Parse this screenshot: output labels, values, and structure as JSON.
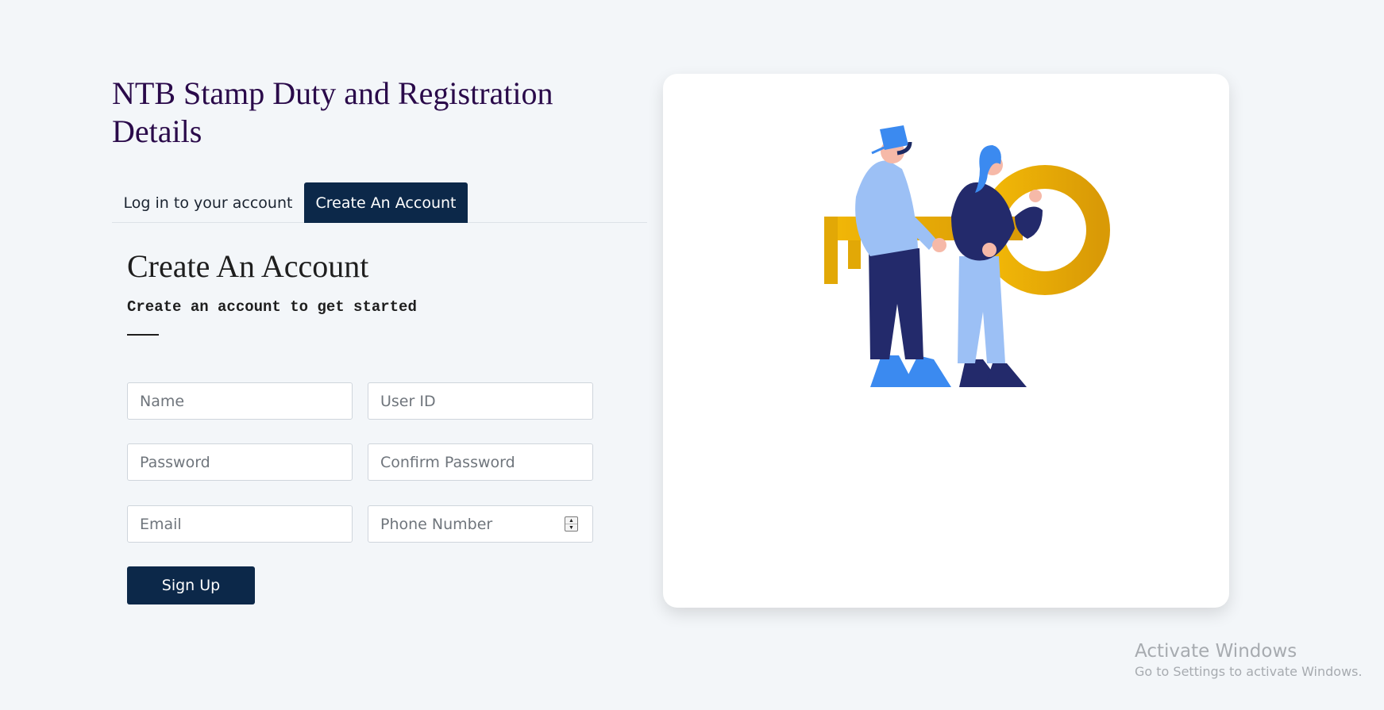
{
  "app": {
    "title": "NTB Stamp Duty and Registration Details"
  },
  "tabs": [
    {
      "label": "Log in to your account",
      "active": false
    },
    {
      "label": "Create An Account",
      "active": true
    }
  ],
  "form": {
    "heading": "Create An Account",
    "subheading": "Create an account to get started",
    "fields": {
      "name": {
        "placeholder": "Name",
        "value": ""
      },
      "user_id": {
        "placeholder": "User ID",
        "value": ""
      },
      "password": {
        "placeholder": "Password",
        "value": ""
      },
      "confirm_password": {
        "placeholder": "Confirm Password",
        "value": ""
      },
      "email": {
        "placeholder": "Email",
        "value": ""
      },
      "phone": {
        "placeholder": "Phone Number",
        "value": ""
      }
    },
    "submit_label": "Sign Up"
  },
  "illustration": {
    "icon": "people-carrying-key-illustration"
  },
  "watermark": {
    "title": "Activate Windows",
    "subtitle": "Go to Settings to activate Windows."
  },
  "colors": {
    "primary": "#0c2849",
    "background": "#f3f6f9",
    "title": "#2a0a4a",
    "key_gold": "#e6ae06"
  }
}
